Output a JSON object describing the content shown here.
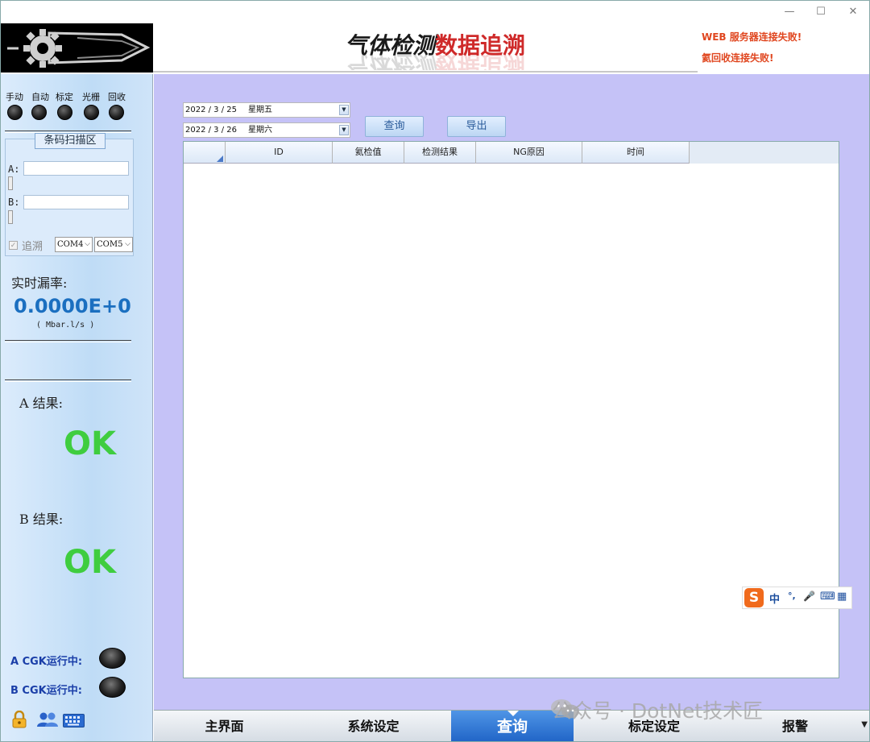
{
  "window": {
    "controls": {
      "minimize": "—",
      "maximize": "☐",
      "close": "✕"
    }
  },
  "header": {
    "title_part1": "气体检测",
    "title_part2": "数据追溯",
    "status_lines": [
      "WEB 服务器连接失败!",
      "氦回收连接失败!"
    ]
  },
  "left_panel": {
    "modes": [
      "手动",
      "自动",
      "标定",
      "光栅",
      "回收"
    ],
    "scan_area": {
      "legend": "条码扫描区",
      "label_a": "A:",
      "label_b": "B:",
      "value_a": "",
      "value_b": "",
      "trace_label": "追溯",
      "trace_checked": true,
      "port_a": "COM4",
      "port_b": "COM5"
    },
    "leak_rate": {
      "label": "实时漏率:",
      "value": "0.0000E+0",
      "unit": "( Mbar.l/s )"
    },
    "result_a": {
      "label": "A 结果:",
      "value": "OK"
    },
    "result_b": {
      "label": "B 结果:",
      "value": "OK"
    },
    "cgk_a": "A CGK运行中:",
    "cgk_b": "B CGK运行中:",
    "toolbar_icons": [
      "lock-icon",
      "users-icon",
      "keyboard-icon"
    ]
  },
  "query": {
    "start_date": "2022 / 3 / 25",
    "start_weekday": "星期五",
    "end_date": "2022 / 3 / 26",
    "end_weekday": "星期六",
    "query_button": "查询",
    "export_button": "导出"
  },
  "table": {
    "columns": [
      "ID",
      "氦检值",
      "检测结果",
      "NG原因",
      "时间"
    ],
    "rows": []
  },
  "ime_toolbar": {
    "logo": "S",
    "items": [
      "中",
      "°,",
      "🎤",
      "⌨",
      "▦"
    ]
  },
  "nav": {
    "items": [
      "主界面",
      "系统设定",
      "查询",
      "标定设定",
      "报警"
    ],
    "active": "查询"
  },
  "watermark": "公众号 · DotNet技术匠",
  "colors": {
    "main_bg": "#c5c2f7",
    "ok_green": "#3fcd3f",
    "leak_blue": "#1b6fc0",
    "status_red": "#e0461f",
    "nav_active": "#1f63c6"
  }
}
